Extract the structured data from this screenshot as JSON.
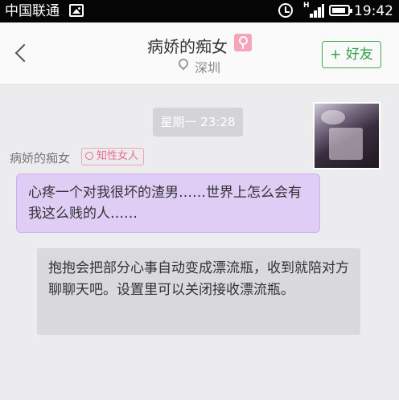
{
  "status_bar": {
    "carrier": "中国联通",
    "time": "19:42",
    "signal_label": "H"
  },
  "header": {
    "title": "病娇的痴女",
    "location": "深圳",
    "add_friend_label": "+ 好友"
  },
  "chat": {
    "timestamp": "星期一 23:28",
    "sender_name": "病娇的痴女",
    "sender_tag": "知性女人",
    "message": "心疼一个对我很坏的渣男……世界上怎么会有我这么贱的人……",
    "system_notice": "抱抱会把部分心事自动变成漂流瓶，收到就陪对方聊聊天吧。设置里可以关闭接收漂流瓶。"
  },
  "colors": {
    "accent_green": "#2f9f47",
    "bubble_purple": "#e0cdf6",
    "female_pink": "#f7a3ba"
  }
}
